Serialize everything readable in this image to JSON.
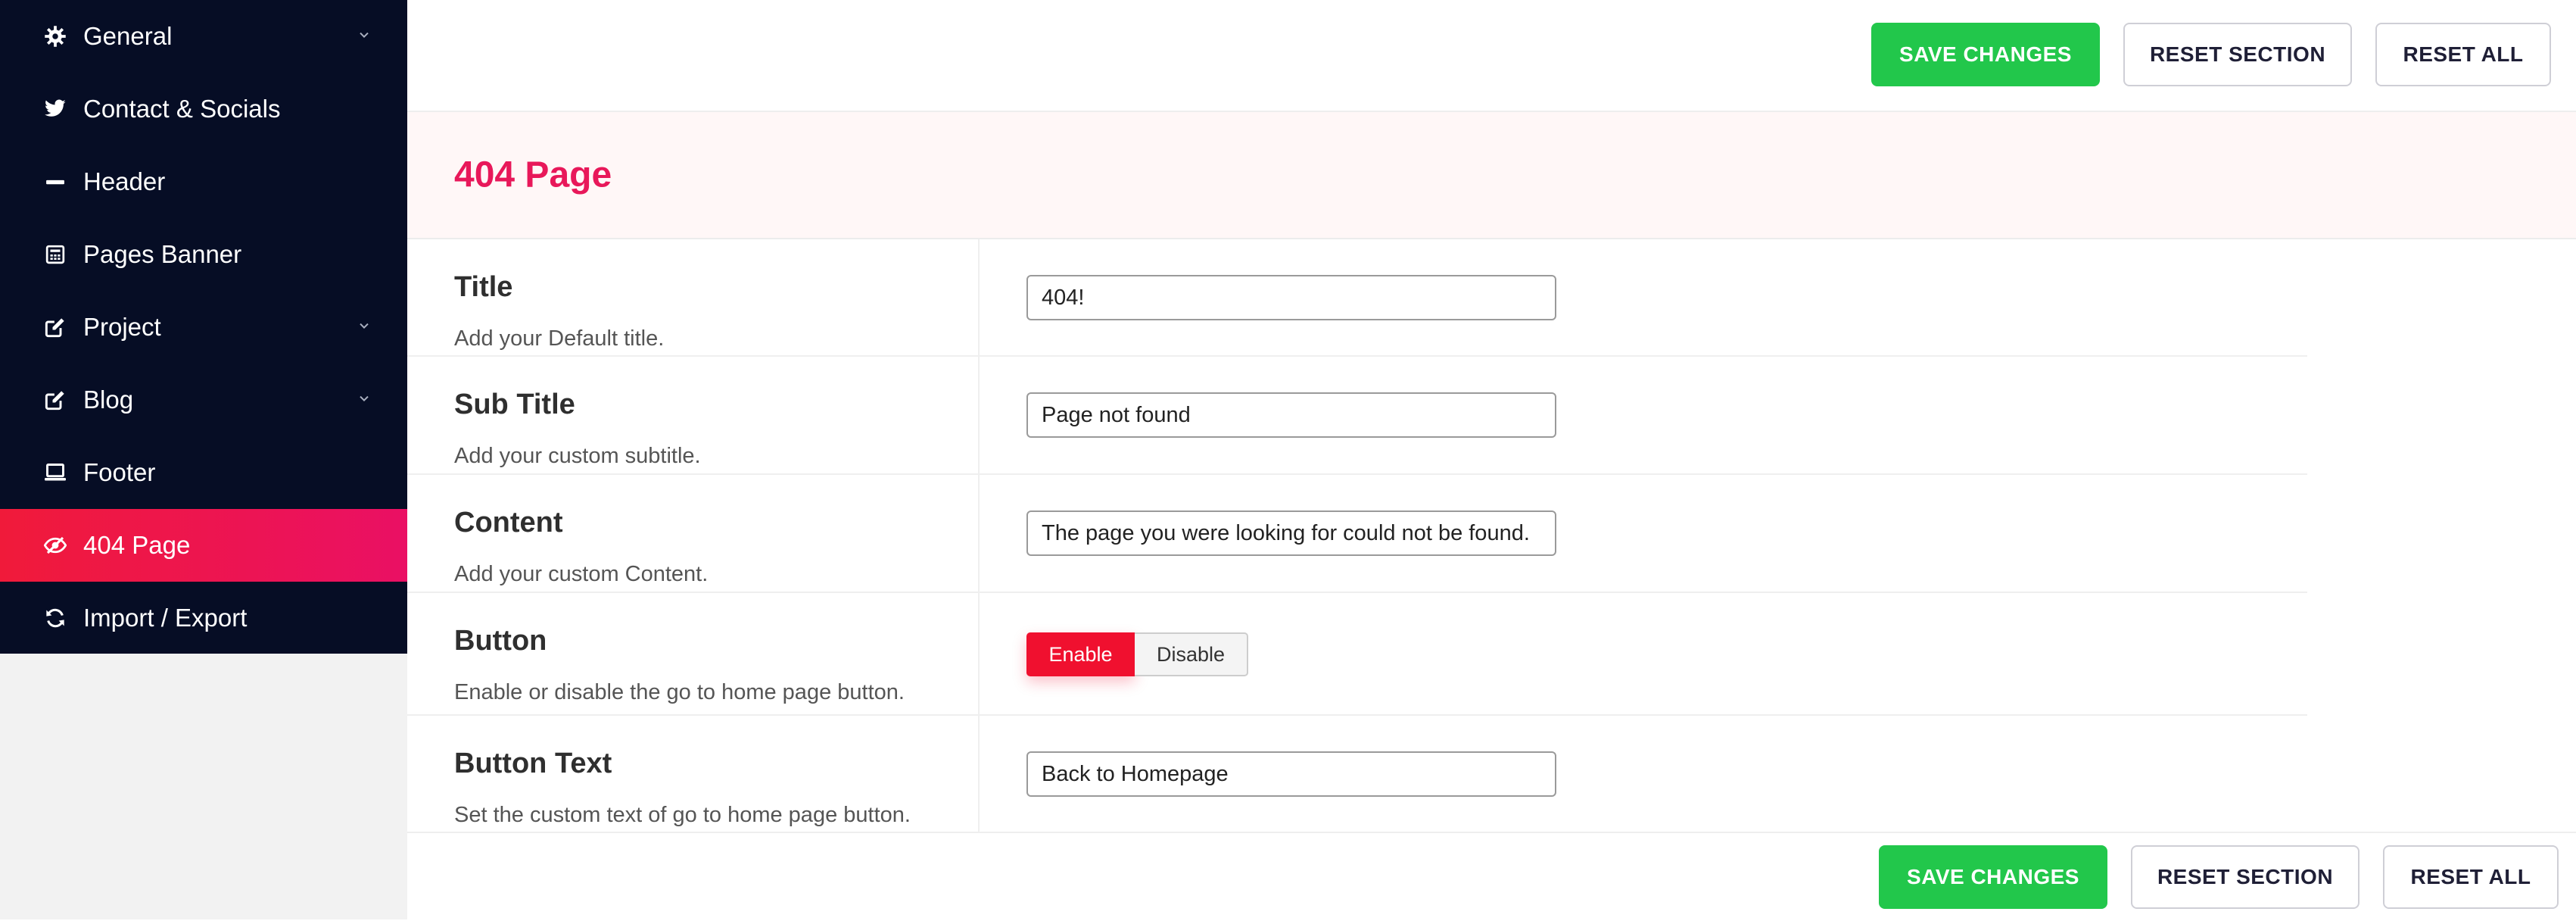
{
  "sidebar": {
    "items": [
      {
        "label": "General",
        "icon": "gear-icon",
        "has_submenu": true
      },
      {
        "label": "Contact & Socials",
        "icon": "twitter-icon",
        "has_submenu": false
      },
      {
        "label": "Header",
        "icon": "minus-icon",
        "has_submenu": false
      },
      {
        "label": "Pages Banner",
        "icon": "calculator-icon",
        "has_submenu": false
      },
      {
        "label": "Project",
        "icon": "edit-icon",
        "has_submenu": true
      },
      {
        "label": "Blog",
        "icon": "edit-icon",
        "has_submenu": true
      },
      {
        "label": "Footer",
        "icon": "laptop-icon",
        "has_submenu": false
      },
      {
        "label": "404 Page",
        "icon": "eye-slash-icon",
        "has_submenu": false,
        "active": true
      },
      {
        "label": "Import / Export",
        "icon": "refresh-icon",
        "has_submenu": false
      }
    ]
  },
  "toolbar": {
    "save_label": "SAVE CHANGES",
    "reset_section_label": "RESET SECTION",
    "reset_all_label": "RESET ALL"
  },
  "section": {
    "title": "404 Page"
  },
  "fields": {
    "title": {
      "label": "Title",
      "description": "Add your Default title.",
      "value": "404!"
    },
    "subtitle": {
      "label": "Sub Title",
      "description": "Add your custom subtitle.",
      "value": "Page not found"
    },
    "content": {
      "label": "Content",
      "description": "Add your custom Content.",
      "value": "The page you were looking for could not be found."
    },
    "button": {
      "label": "Button",
      "description": "Enable or disable the go to home page button.",
      "enable_label": "Enable",
      "disable_label": "Disable",
      "selected": "Enable"
    },
    "button_text": {
      "label": "Button Text",
      "description": "Set the custom text of go to home page button.",
      "value": "Back to Homepage"
    }
  },
  "colors": {
    "sidebar_bg": "#060d25",
    "active_gradient_start": "#f01a3a",
    "active_gradient_end": "#ea1064",
    "accent_title": "#e8185a",
    "save_green": "#22c74b",
    "enable_red": "#f0102f"
  }
}
